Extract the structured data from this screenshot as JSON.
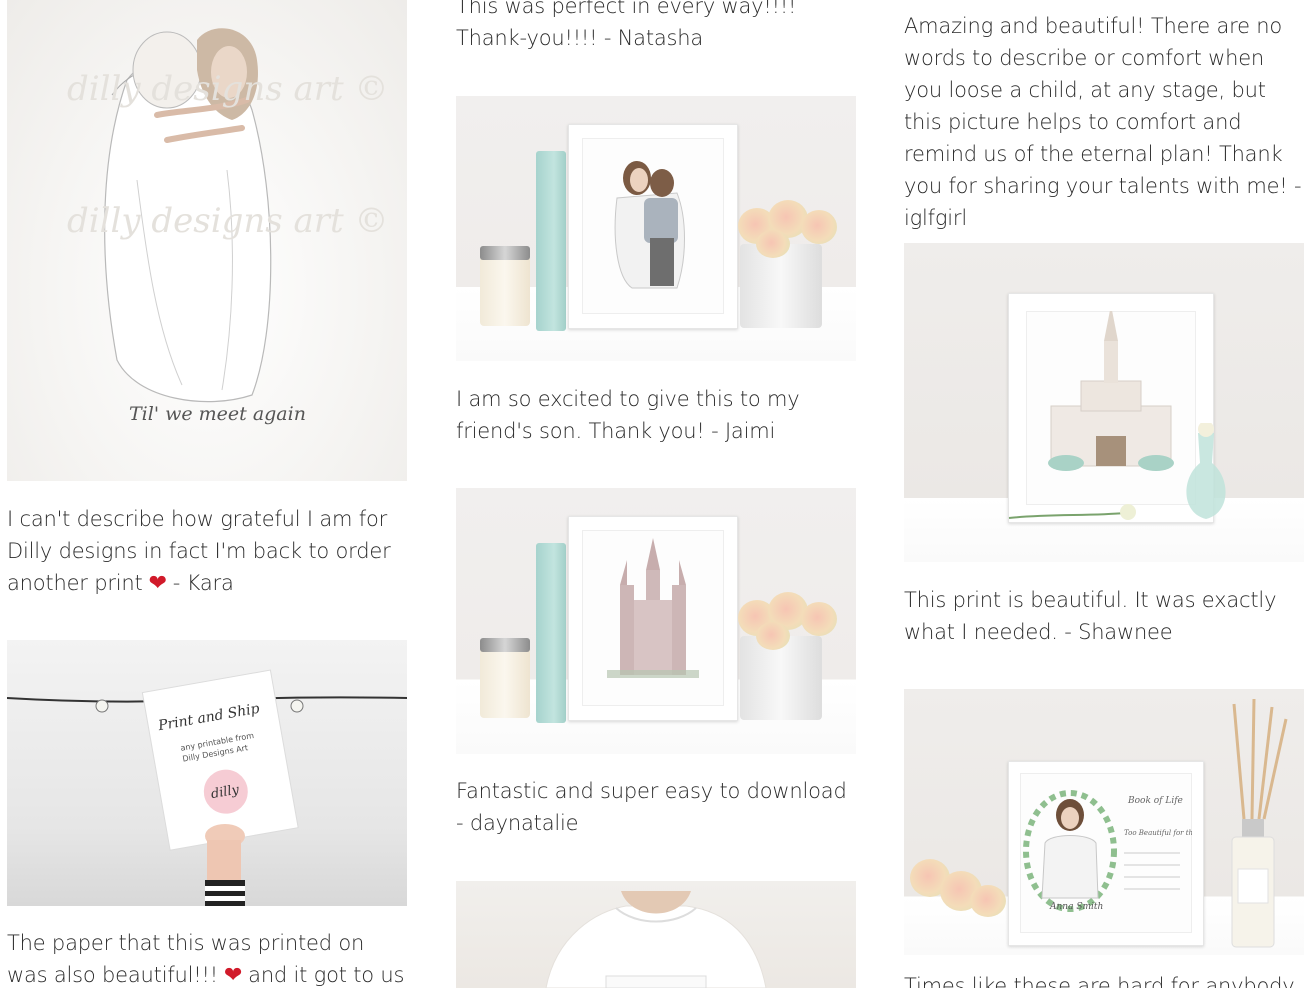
{
  "testimonials": {
    "col1": [
      {
        "image_alt": "Print: Til' we meet again",
        "image_text": "Til' we meet again",
        "watermark": "dilly designs art ©",
        "caption_before": "I can't describe how grateful I am for Dilly designs in fact I'm back to order another print",
        "caption_after": "- Kara"
      },
      {
        "image_alt": "Print and Ship card",
        "card_title": "Print and Ship",
        "card_line1": "any printable from",
        "card_line2": "Dilly Designs Art",
        "card_logo": "dilly",
        "caption_before": "The paper that this was printed on was also beautiful!!!",
        "caption_after": "and it got to us"
      }
    ],
    "col2": [
      {
        "caption": "This was perfect in every way!!!! Thank-you!!!! - Natasha"
      },
      {
        "image_alt": "Framed embrace print on shelf",
        "caption": "I am so excited to give this to my friend's son. Thank you! - Jaimi"
      },
      {
        "image_alt": "Framed temple print on shelf",
        "caption": "Fantastic and super easy to download - daynatalie"
      },
      {
        "image_alt": "Person holding framed print"
      }
    ],
    "col3": [
      {
        "caption": "Amazing and beautiful! There are no words to describe or comfort when you loose a child, at any stage, but this picture helps to comfort and remind us of the eternal plan! Thank you for sharing your talents with me! - iglfgirl"
      },
      {
        "image_alt": "Framed temple print with vase",
        "caption": "This print is beautiful. It was exactly what I needed. - Shawnee"
      },
      {
        "image_alt": "Framed Book of Life print with flowers",
        "print_name": "Anna Smith",
        "print_title": "Book of Life",
        "print_subtitle": "Too Beautiful for this Earth",
        "caption": "Times like these are hard for anybody"
      }
    ]
  },
  "colors": {
    "heart": "#d11a2a",
    "text": "#2a2a2a",
    "accent_teal": "#a6d3cd"
  },
  "icons": {
    "heart": "heart-icon"
  }
}
